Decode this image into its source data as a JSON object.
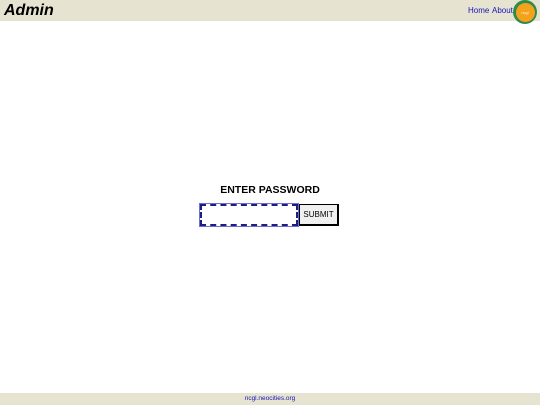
{
  "header": {
    "title": "Admin",
    "nav": {
      "home": "Home",
      "about": "About"
    },
    "logo_text": "ncgl",
    "background": "#e6e4d0"
  },
  "form": {
    "title": "ENTER PASSWORD",
    "password_value": "",
    "submit_label": "SUBMIT"
  },
  "footer": {
    "link": "ncgl.neocities.org"
  },
  "colors": {
    "link": "#1a12b8",
    "logo_ring": "#2f8a4c",
    "logo_fill": "#f2a31b",
    "input_border": "#1c1c8a"
  }
}
